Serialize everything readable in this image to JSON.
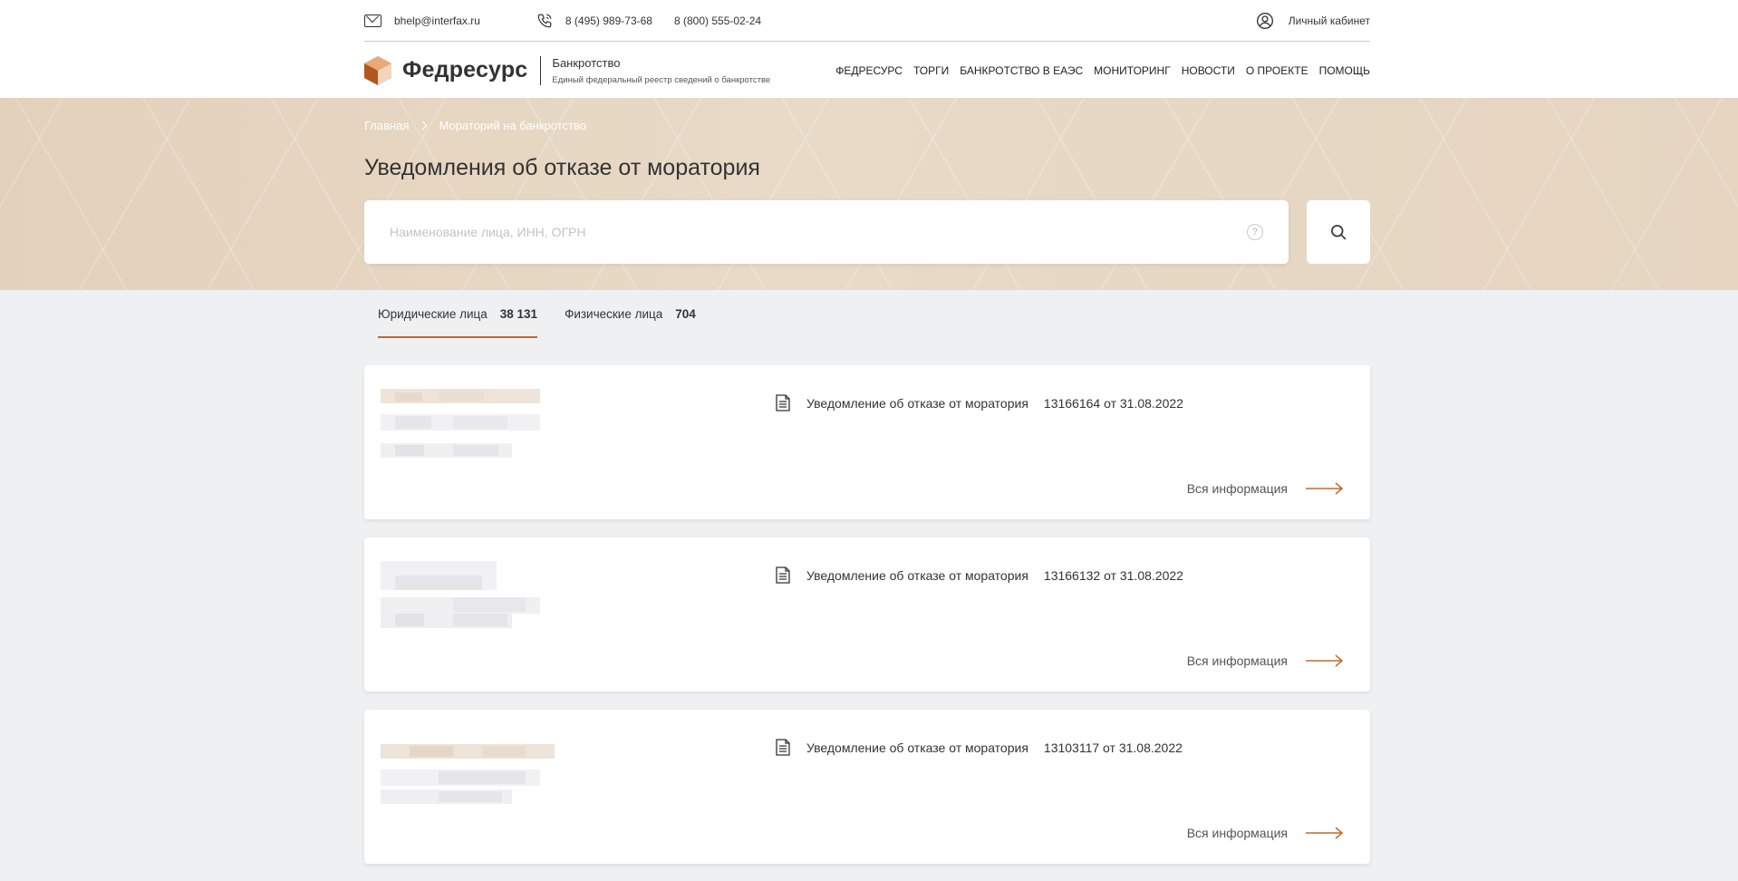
{
  "topline": {
    "email": "bhelp@interfax.ru",
    "phone1": "8 (495) 989-73-68",
    "phone2": "8 (800) 555-02-24",
    "cabinet": "Личный кабинет"
  },
  "brand": {
    "logo": "Федресурс",
    "section": "Банкротство",
    "tagline": "Единый федеральный реестр сведений о банкротстве"
  },
  "nav": [
    "ФЕДРЕСУРС",
    "ТОРГИ",
    "БАНКРОТСТВО В ЕАЭС",
    "МОНИТОРИНГ",
    "НОВОСТИ",
    "О ПРОЕКТЕ",
    "ПОМОЩЬ"
  ],
  "breadcrumb": {
    "home": "Главная",
    "current": "Мораторий на банкротство"
  },
  "page_title": "Уведомления об отказе от моратория",
  "search": {
    "placeholder": "Наименование лица, ИНН, ОГРН",
    "help": "?"
  },
  "tabs": [
    {
      "label": "Юридические лица",
      "count": "38 131",
      "active": true
    },
    {
      "label": "Физические лица",
      "count": "704",
      "active": false
    }
  ],
  "cards": [
    {
      "doc_title": "Уведомление об отказе от моратория",
      "doc_number": "13166164 от 31.08.2022",
      "more": "Вся информация"
    },
    {
      "doc_title": "Уведомление об отказе от моратория",
      "doc_number": "13166132 от 31.08.2022",
      "more": "Вся информация"
    },
    {
      "doc_title": "Уведомление об отказе от моратория",
      "doc_number": "13103117 от 31.08.2022",
      "more": "Вся информация"
    }
  ],
  "colors": {
    "accent": "#c26a2e",
    "hero": "#e5d5c1",
    "background": "#eef0f2"
  }
}
